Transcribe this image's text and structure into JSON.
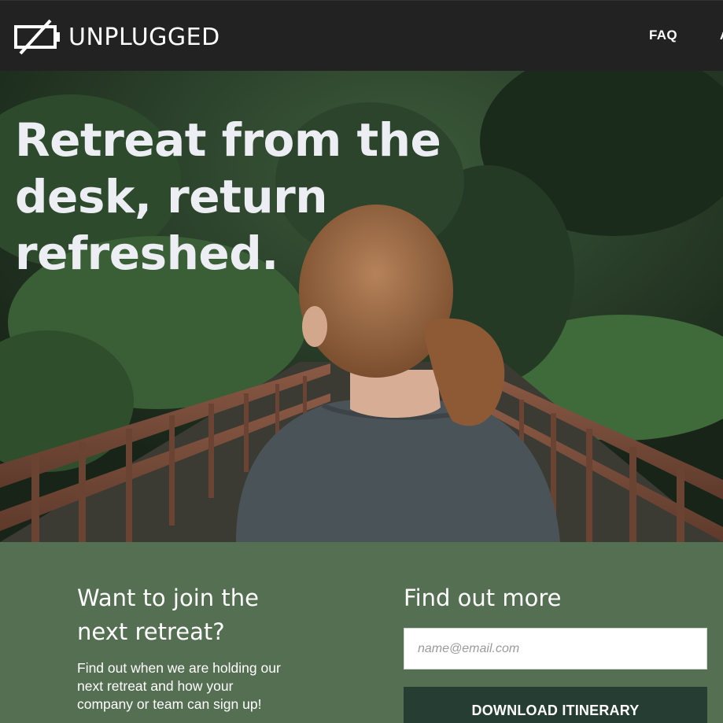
{
  "header": {
    "brand": "UNPLUGGED",
    "logo_icon": "battery-slash-icon",
    "nav": [
      "FAQ",
      "A"
    ]
  },
  "hero": {
    "title": "Retreat from the desk, return refreshed.",
    "image": "woman-on-forest-bridge-photo"
  },
  "signup": {
    "join_title": "Want to join the next retreat?",
    "join_text": "Find out when we are holding our next retreat and how your company or team can sign up!",
    "more_title": "Find out more",
    "email_placeholder": "name@email.com",
    "download_label": "DOWNLOAD ITINERARY"
  },
  "colors": {
    "header_bg": "#222222",
    "signup_bg": "#546f51",
    "button_bg": "#263d33",
    "text": "#ffffff"
  }
}
